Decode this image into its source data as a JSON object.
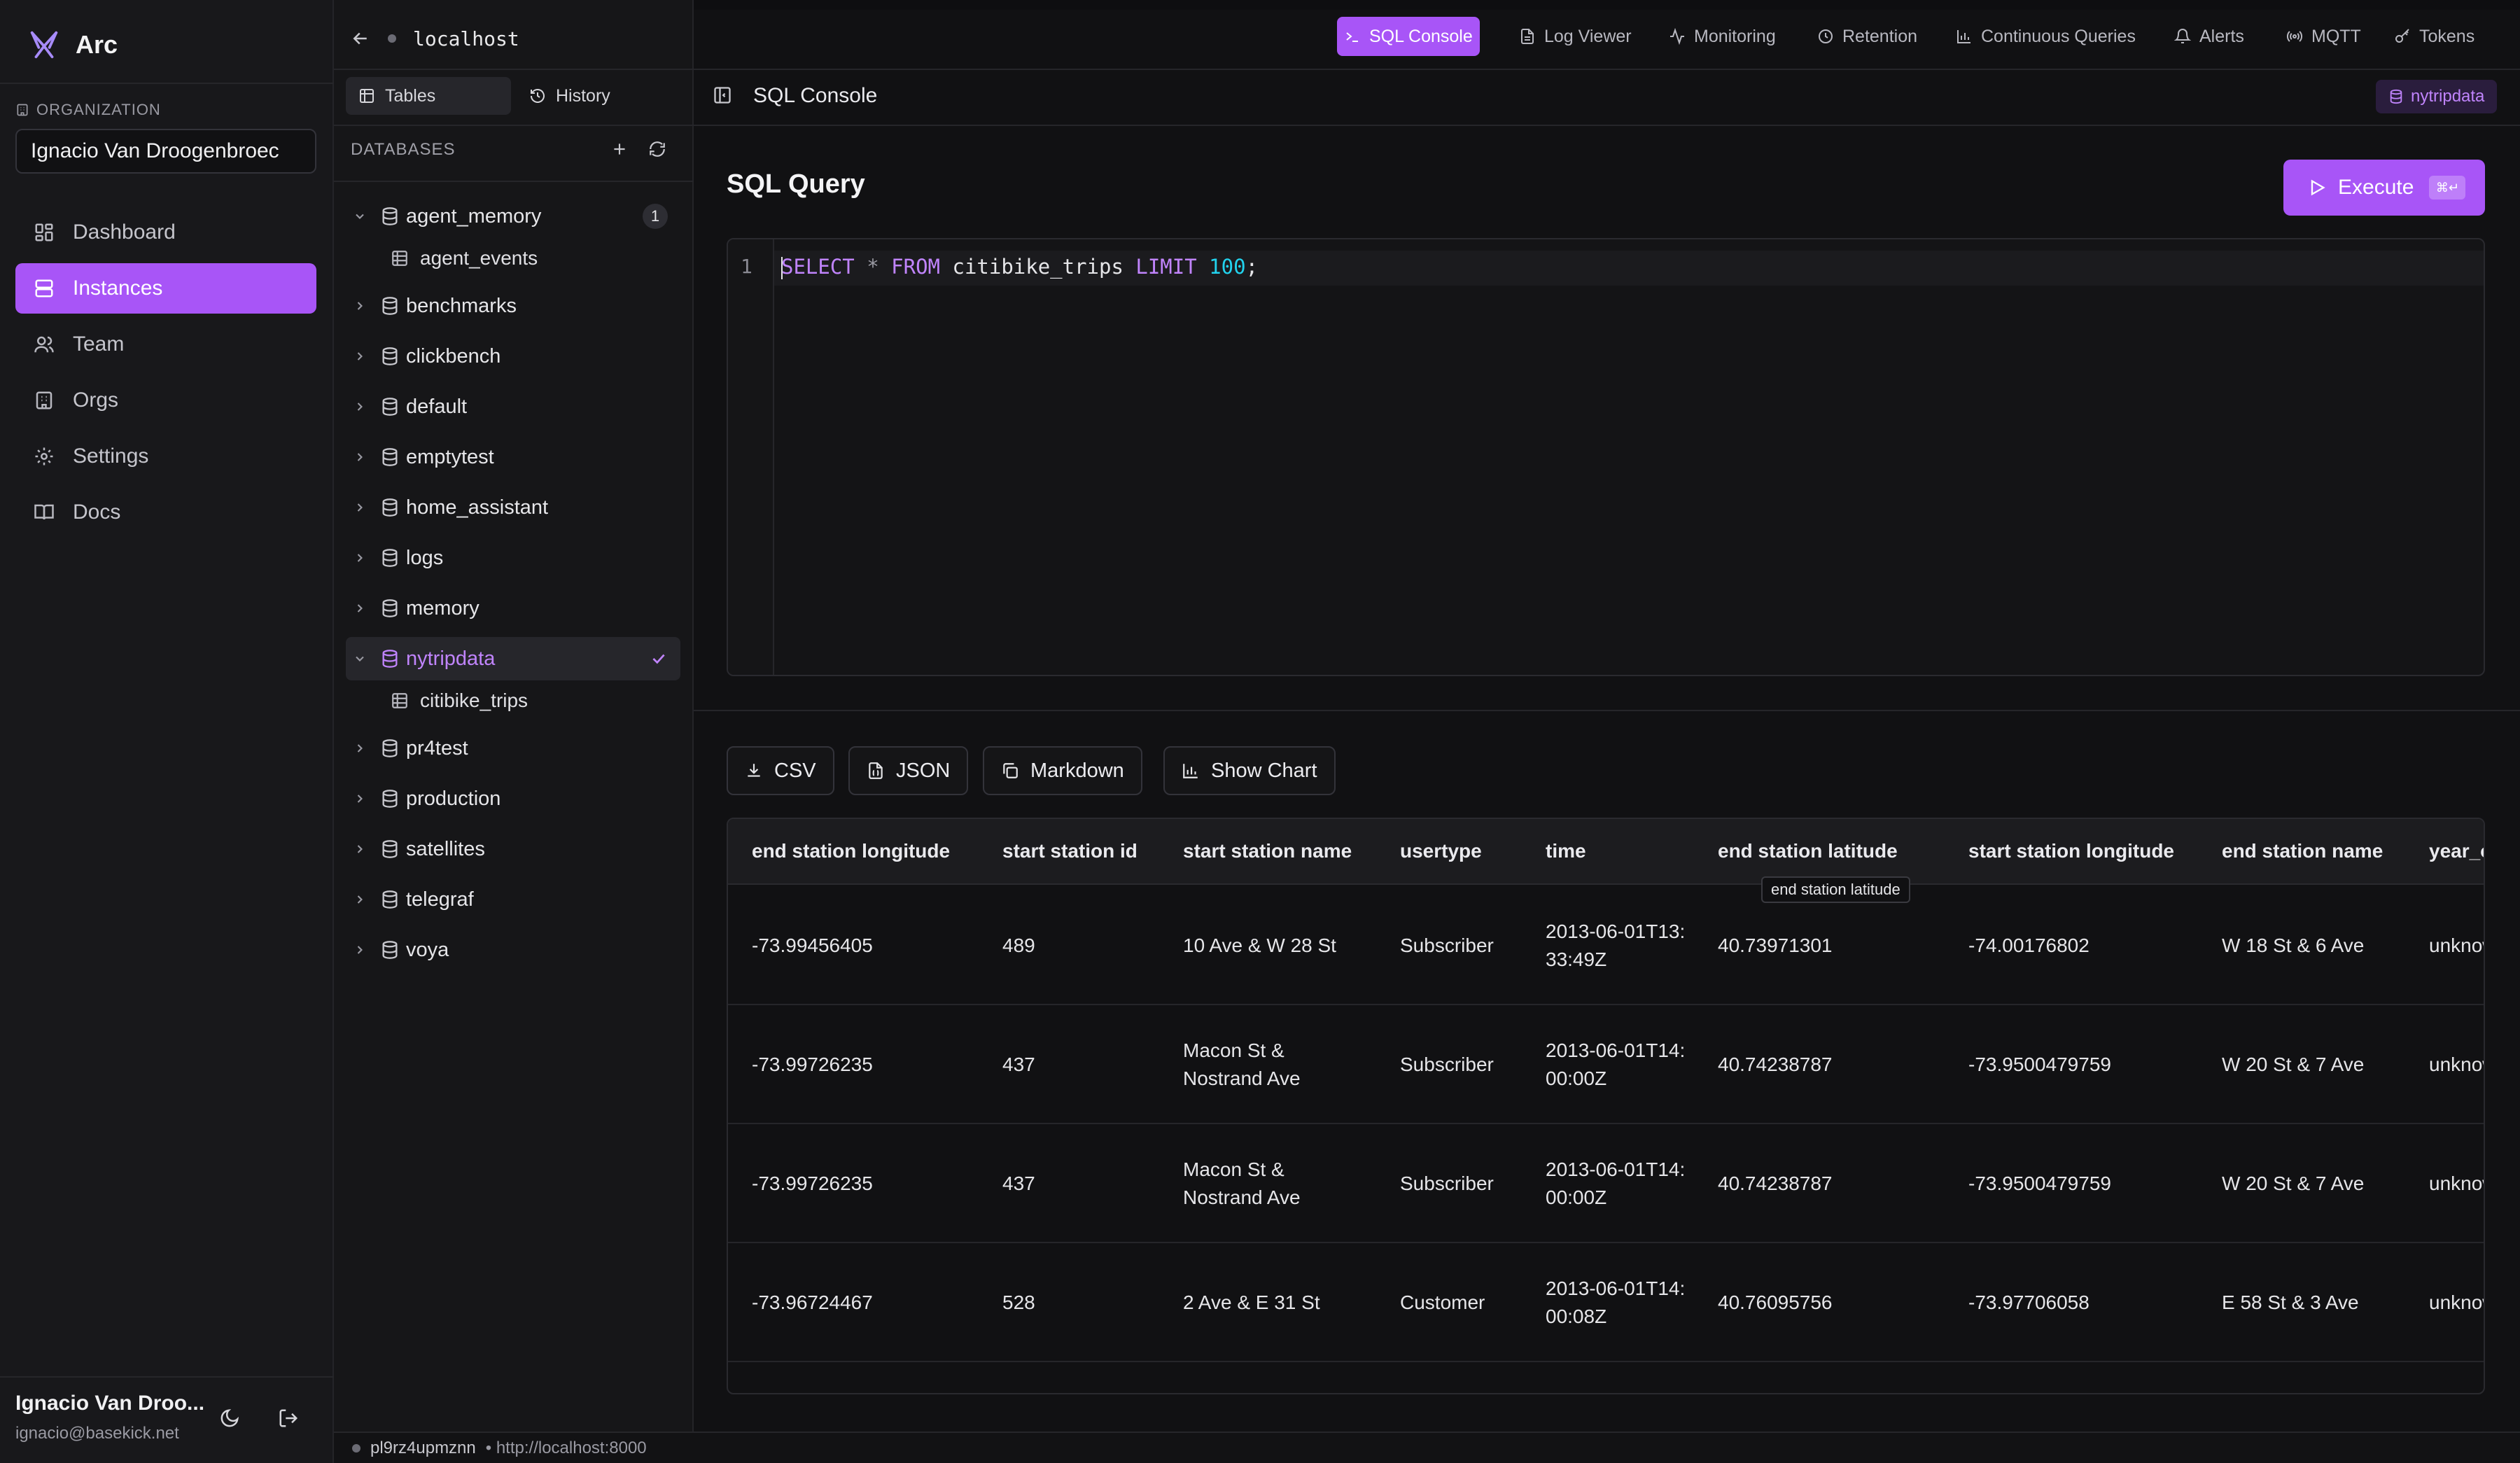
{
  "app": {
    "name": "Arc"
  },
  "organization": {
    "label": "ORGANIZATION",
    "value": "Ignacio Van Droogenbroec"
  },
  "nav": [
    {
      "label": "Dashboard",
      "icon": "grid-icon",
      "active": false
    },
    {
      "label": "Instances",
      "icon": "server-icon",
      "active": true
    },
    {
      "label": "Team",
      "icon": "users-icon",
      "active": false
    },
    {
      "label": "Orgs",
      "icon": "building-icon",
      "active": false
    },
    {
      "label": "Settings",
      "icon": "gear-icon",
      "active": false
    },
    {
      "label": "Docs",
      "icon": "book-icon",
      "active": false
    }
  ],
  "user": {
    "name": "Ignacio Van Droo...",
    "email": "ignacio@basekick.net"
  },
  "instance": {
    "host": "localhost",
    "id": "pl9rz4upmznn",
    "url": "• http://localhost:8000"
  },
  "explorer": {
    "tabs": [
      {
        "label": "Tables",
        "active": true
      },
      {
        "label": "History",
        "active": false
      }
    ],
    "heading": "DATABASES",
    "databases": [
      {
        "name": "agent_memory",
        "expanded": true,
        "badge": "1",
        "tables": [
          "agent_events"
        ]
      },
      {
        "name": "benchmarks"
      },
      {
        "name": "clickbench"
      },
      {
        "name": "default"
      },
      {
        "name": "emptytest"
      },
      {
        "name": "home_assistant"
      },
      {
        "name": "logs"
      },
      {
        "name": "memory"
      },
      {
        "name": "nytripdata",
        "expanded": true,
        "selected": true,
        "tables": [
          "citibike_trips"
        ]
      },
      {
        "name": "pr4test"
      },
      {
        "name": "production"
      },
      {
        "name": "satellites"
      },
      {
        "name": "telegraf"
      },
      {
        "name": "voya"
      }
    ]
  },
  "topnav": [
    {
      "label": "SQL Console",
      "icon": "terminal-icon",
      "active": true
    },
    {
      "label": "Log Viewer",
      "icon": "file-icon",
      "active": false
    },
    {
      "label": "Monitoring",
      "icon": "activity-icon",
      "active": false
    },
    {
      "label": "Retention",
      "icon": "clock-icon",
      "active": false
    },
    {
      "label": "Continuous Queries",
      "icon": "bar-chart-icon",
      "active": false
    },
    {
      "label": "Alerts",
      "icon": "bell-icon",
      "active": false
    },
    {
      "label": "MQTT",
      "icon": "radio-icon",
      "active": false
    },
    {
      "label": "Tokens",
      "icon": "key-icon",
      "active": false
    }
  ],
  "console": {
    "title": "SQL Console",
    "db_chip": "nytripdata",
    "query_title": "SQL Query",
    "execute_label": "Execute",
    "execute_shortcut": "⌘↵",
    "line_number": "1",
    "query": {
      "kw_select": "SELECT",
      "star": "*",
      "kw_from": "FROM",
      "table": "citibike_trips",
      "kw_limit": "LIMIT",
      "limit": "100",
      "end": ";"
    }
  },
  "export": [
    {
      "label": "CSV",
      "icon": "download-icon"
    },
    {
      "label": "JSON",
      "icon": "file-json-icon"
    },
    {
      "label": "Markdown",
      "icon": "copy-icon"
    },
    {
      "label": "Show Chart",
      "icon": "bar-chart-icon"
    }
  ],
  "results": {
    "tooltip": "end station latitude",
    "columns": [
      "end station longitude",
      "start station id",
      "start station name",
      "usertype",
      "time",
      "end station latitude",
      "start station longitude",
      "end station name",
      "year_o"
    ],
    "rows": [
      [
        "-73.99456405",
        "489",
        "10 Ave & W 28 St",
        "Subscriber",
        "2013-06-01T13:33:49Z",
        "40.73971301",
        "-74.00176802",
        "W 18 St & 6 Ave",
        "unknown"
      ],
      [
        "-73.99726235",
        "437",
        "Macon St & Nostrand Ave",
        "Subscriber",
        "2013-06-01T14:00:00Z",
        "40.74238787",
        "-73.9500479759",
        "W 20 St & 7 Ave",
        "unknown"
      ],
      [
        "-73.99726235",
        "437",
        "Macon St & Nostrand Ave",
        "Subscriber",
        "2013-06-01T14:00:00Z",
        "40.74238787",
        "-73.9500479759",
        "W 20 St & 7 Ave",
        "unknown"
      ],
      [
        "-73.96724467",
        "528",
        "2 Ave & E 31 St",
        "Customer",
        "2013-06-01T14:00:08Z",
        "40.76095756",
        "-73.97706058",
        "E 58 St & 3 Ave",
        "unknown"
      ]
    ]
  }
}
